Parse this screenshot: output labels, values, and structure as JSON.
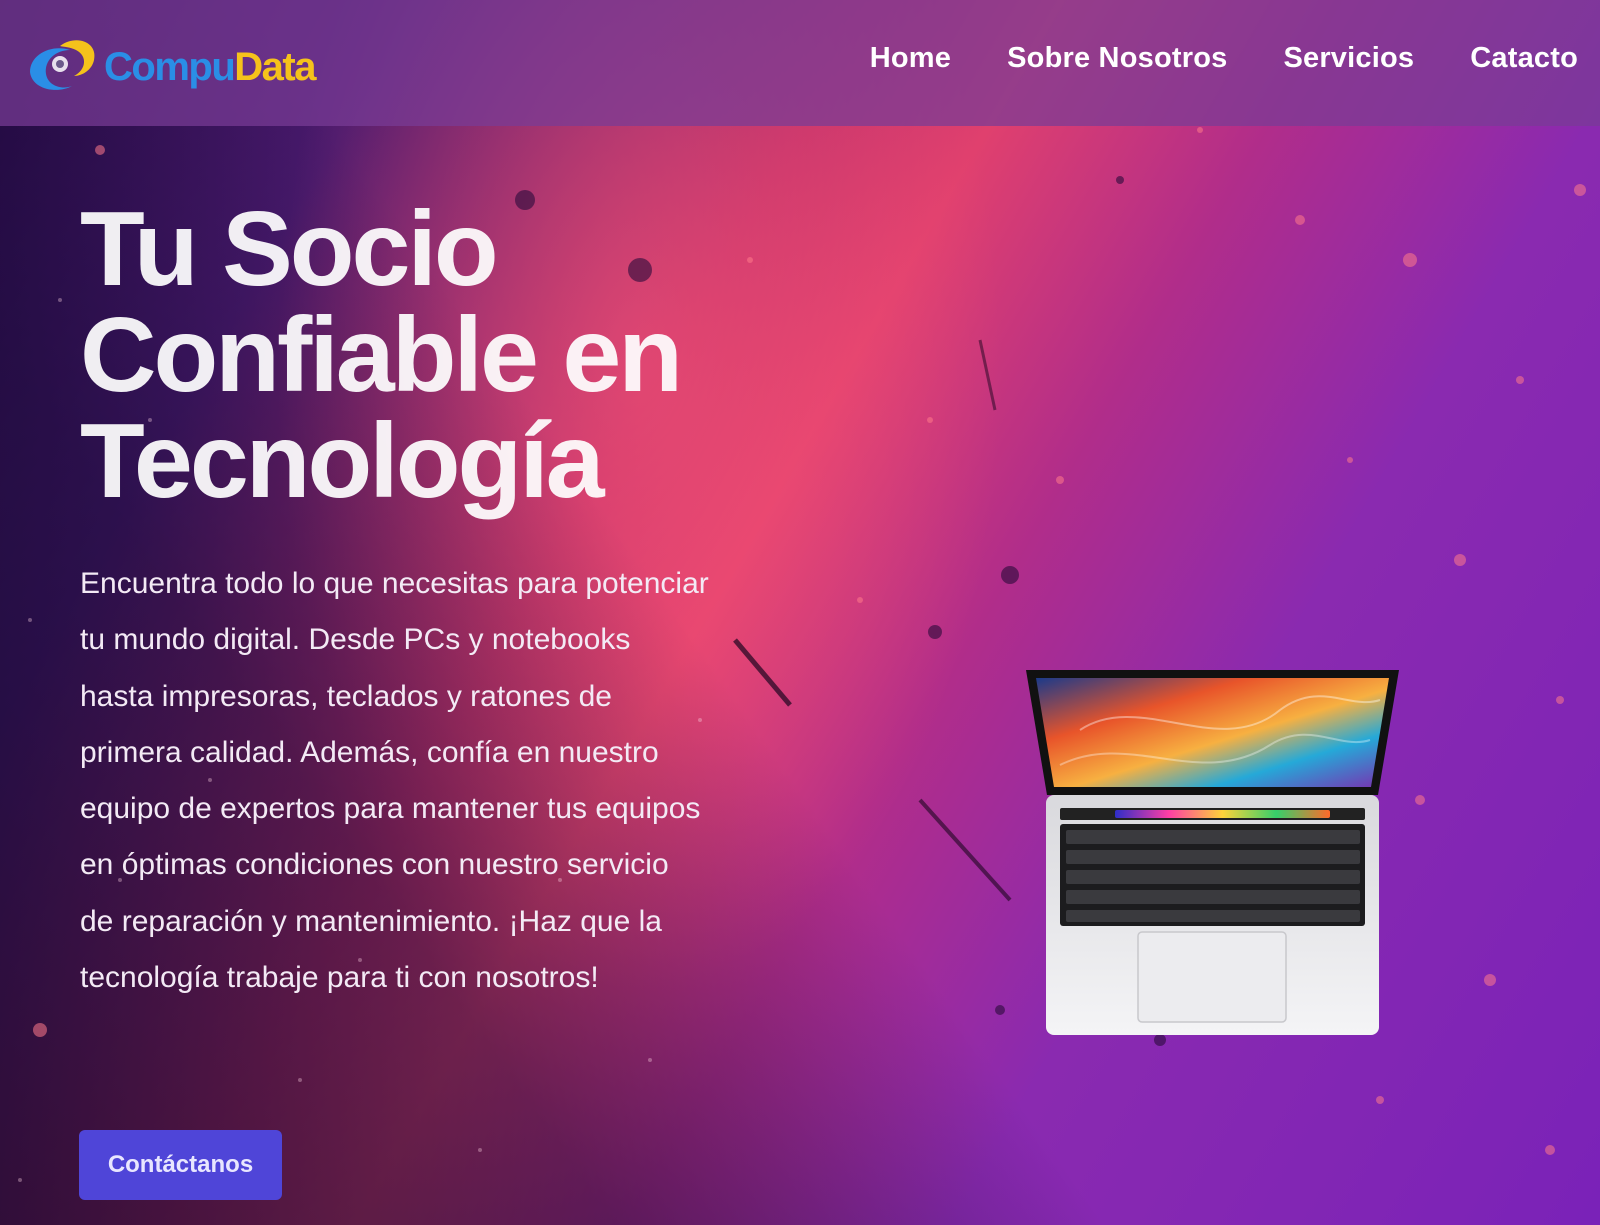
{
  "brand": {
    "logo_text_part1": "Compu",
    "logo_text_part2": "Data",
    "colors": {
      "logo_blue": "#2a8ee6",
      "logo_yellow": "#f5c21b"
    }
  },
  "nav": {
    "items": [
      {
        "label": "Home"
      },
      {
        "label": "Sobre Nosotros"
      },
      {
        "label": "Servicios"
      },
      {
        "label": "Catacto"
      }
    ]
  },
  "hero": {
    "title_line1": "Tu Socio",
    "title_line2": "Confiable en",
    "title_line3": "Tecnología",
    "description": "Encuentra todo lo que necesitas para potenciar tu mundo digital. Desde PCs y notebooks hasta impresoras, teclados y ratones de primera calidad. Además, confía en nuestro equipo de expertos para mantener tus equipos en óptimas condiciones con nuestro servicio de reparación y mantenimiento. ¡Haz que la tecnología trabaje para ti con nosotros!",
    "cta_label": "Contáctanos",
    "image": "laptop-image"
  },
  "colors": {
    "accent_button": "#4f45d8",
    "navbar_bg": "#7a3c96"
  }
}
